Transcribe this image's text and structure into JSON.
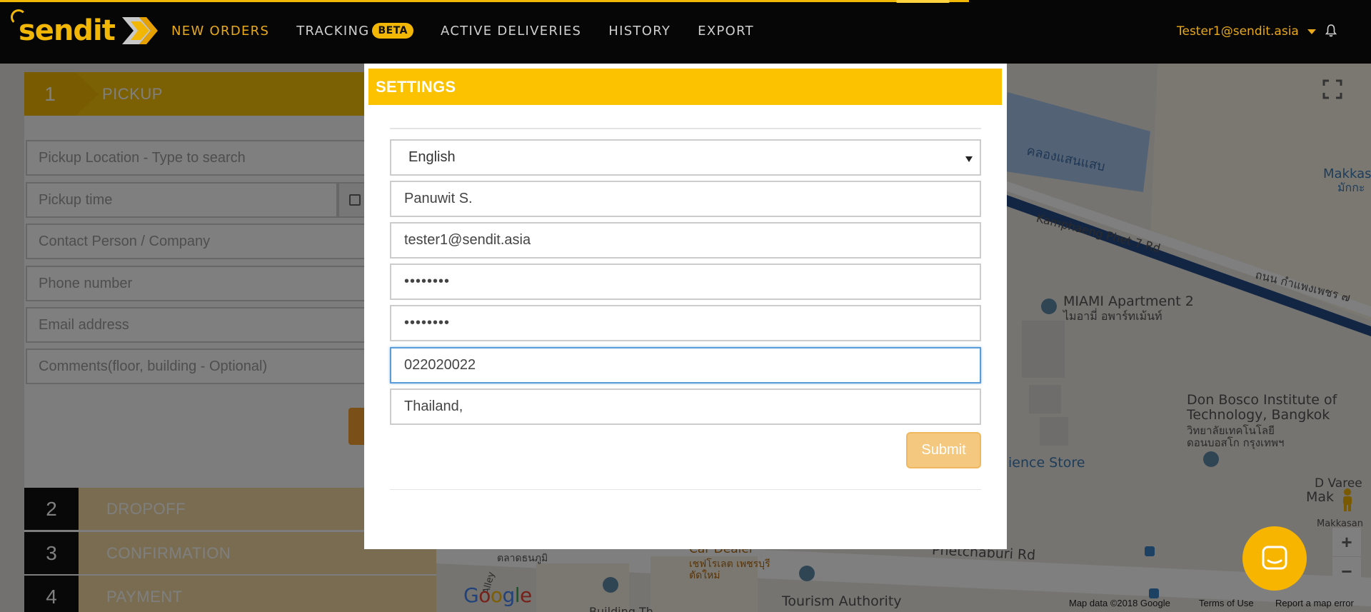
{
  "brand": {
    "logo_text": "sendit",
    "accent": "#f2b705",
    "nav_active": "#e8a91a"
  },
  "nav": {
    "items": [
      {
        "label": "NEW ORDERS",
        "active": true
      },
      {
        "label": "TRACKING",
        "badge": "BETA",
        "active": false
      },
      {
        "label": "ACTIVE DELIVERIES",
        "active": false
      },
      {
        "label": "HISTORY",
        "active": false
      },
      {
        "label": "EXPORT",
        "active": false
      }
    ],
    "user_email": "Tester1@sendit.asia",
    "icons": {
      "user_menu": "caret-down-icon",
      "notifications": "bell-icon"
    }
  },
  "left_panel": {
    "step1": {
      "number": "1",
      "label": "PICKUP"
    },
    "fields": {
      "pickup_location": "Pickup Location - Type to search",
      "pickup_time": "Pickup time",
      "contact": "Contact Person / Company",
      "phone": "Phone number",
      "email": "Email address",
      "comments": "Comments(floor, building - Optional)"
    },
    "steps": [
      {
        "number": "2",
        "label": "DROPOFF"
      },
      {
        "number": "3",
        "label": "CONFIRMATION"
      },
      {
        "number": "4",
        "label": "PAYMENT"
      }
    ]
  },
  "map": {
    "labels": {
      "canal": "คลองแสนแสบ",
      "road_en": "Kamphaeng Phet 7 Rd",
      "road_th": "ถนน กำแพงเพชร ๗",
      "makkasan_en": "Makkas",
      "makkasan_th": "มักกะ",
      "miami_en": "MIAMI Apartment 2",
      "miami_th": "ไมอามี่ อพาร์ทเม้นท์",
      "donbosco_en_1": "Don Bosco Institute of",
      "donbosco_en_2": "Technology, Bangkok",
      "donbosco_th_1": "วิทยาลัยเทคโนโลยี",
      "donbosco_th_2": "ดอนบอสโก กรุงเทพฯ",
      "store": "ience Store",
      "d_vare": "D Varee",
      "mak_right": "Mak",
      "makkasan_small": "Makkasan",
      "petchaburi": "Phetchaburi Rd",
      "car_dealer": "Car Dealer",
      "car_dealer_th_1": "เชฟโรเลต เพชรบุรี",
      "car_dealer_th_2": "ตัดใหม่",
      "market_th": "ตลาดธนภูมิ",
      "alley": "Alley",
      "tourism": "Tourism Authority",
      "building": "Building Th"
    },
    "footer": {
      "attribution": "Map data ©2018 Google",
      "terms": "Terms of Use",
      "report": "Report a map error"
    },
    "google_logo": "Google",
    "zoom_in": "+",
    "zoom_out": "−"
  },
  "modal": {
    "title": "SETTINGS",
    "language": "English",
    "name": "Panuwit S.",
    "email": "tester1@sendit.asia",
    "password": "••••••••",
    "password_confirm": "••••••••",
    "phone": "022020022",
    "address": "Thailand,",
    "submit_label": "Submit"
  },
  "chat": {
    "icon": "chat-bubble-icon"
  }
}
